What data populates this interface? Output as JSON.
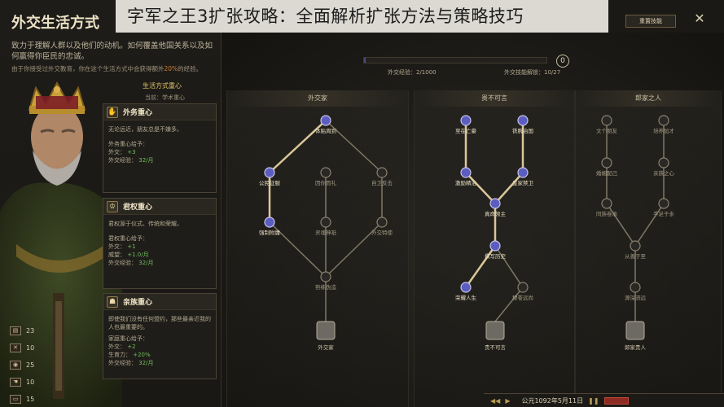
{
  "overlay_title": "字军之王3扩张攻略：全面解析扩张方法与策略技巧",
  "panel": {
    "title": "外交生活方式",
    "intro": "致力于理解人群以及他们的动机。如何覆盖他国关系以及如何赢得你臣民的忠诚。",
    "intro2_prefix": "由于你接受过外交教育，你在这个生活方式中会获得额外",
    "intro2_pct": "20%",
    "intro2_suffix": "的经验。",
    "focus_header": "生活方式重心",
    "focus_current": "当前：学术重心"
  },
  "focus_cards": [
    {
      "name": "外务重心",
      "icon": "handshake-icon",
      "desc": "无论远近，朋友总是不嫌多。",
      "gain_label": "外务重心给予：",
      "line1_label": "外交：",
      "line1_value": "+3",
      "xp_line": "外交经验：",
      "xp_value": "32/月"
    },
    {
      "name": "君权重心",
      "icon": "crown-icon",
      "desc": "君权源于仪式、传统和荣耀。",
      "gain_label": "君权重心给予：",
      "line1_label": "外交：",
      "line1_value": "+1",
      "line2_label": "威望：",
      "line2_value": "+1.0/月",
      "xp_line": "外交经验：",
      "xp_value": "32/月"
    },
    {
      "name": "亲族重心",
      "icon": "family-icon",
      "desc": "即使我们没有任何盟约，那些最亲近我的人也最重要的。",
      "gain_label": "家庭重心给予：",
      "line1_label": "外交：",
      "line1_value": "+2",
      "line2_label": "生育力：",
      "line2_value": "+20%",
      "xp_line": "外交经验：",
      "xp_value": "32/月"
    }
  ],
  "stats": [
    {
      "icon": "scroll-icon",
      "value": "23"
    },
    {
      "icon": "swords-icon",
      "value": "10"
    },
    {
      "icon": "coins-icon",
      "value": "25"
    },
    {
      "icon": "hand-icon",
      "value": "10"
    },
    {
      "icon": "book-icon",
      "value": "15"
    }
  ],
  "header": {
    "encyclopedia_button": "重置技能",
    "xp_label": "外交经验：2/1000",
    "perk_points_label": "外交技能解锁：10/27",
    "perk_points_badge": "0",
    "progress_fraction": 0.002
  },
  "trees": [
    {
      "name": "外交家",
      "nodes": [
        {
          "id": "a1",
          "label": "体贴周到",
          "col": 1,
          "row": 0,
          "unlocked": true
        },
        {
          "id": "a2",
          "label": "公民征服",
          "col": 0,
          "row": 1,
          "unlocked": true
        },
        {
          "id": "a3",
          "label": "因你而礼",
          "col": 1,
          "row": 1,
          "unlocked": false
        },
        {
          "id": "a4",
          "label": "自卫反击",
          "col": 2,
          "row": 1,
          "unlocked": false
        },
        {
          "id": "a5",
          "label": "强制附庸",
          "col": 0,
          "row": 2,
          "unlocked": true
        },
        {
          "id": "a6",
          "label": "灵魂神祇",
          "col": 1,
          "row": 2,
          "unlocked": false
        },
        {
          "id": "a7",
          "label": "外交特使",
          "col": 2,
          "row": 2,
          "unlocked": false
        },
        {
          "id": "a8",
          "label": "熟练伪造",
          "col": 1,
          "row": 3,
          "unlocked": false
        }
      ],
      "capstone": "外交家",
      "edges": [
        [
          "a1",
          "a2"
        ],
        [
          "a1",
          "a4"
        ],
        [
          "a2",
          "a5"
        ],
        [
          "a3",
          "a6"
        ],
        [
          "a4",
          "a7"
        ],
        [
          "a5",
          "a8"
        ],
        [
          "a6",
          "a8"
        ],
        [
          "a7",
          "a8"
        ]
      ]
    },
    {
      "name": "贵不可言",
      "nodes": [
        {
          "id": "b1",
          "label": "至在亡豪",
          "col": 0,
          "row": 0,
          "unlocked": true
        },
        {
          "id": "b2",
          "label": "铁腕治国",
          "col": 2,
          "row": 0,
          "unlocked": true
        },
        {
          "id": "b3",
          "label": "激励精治",
          "col": 0,
          "row": 1,
          "unlocked": true
        },
        {
          "id": "b4",
          "label": "皇家禁卫",
          "col": 2,
          "row": 1,
          "unlocked": true
        },
        {
          "id": "b5",
          "label": "真命领主",
          "col": 1,
          "row": 2,
          "unlocked": true
        },
        {
          "id": "b6",
          "label": "撰写历史",
          "col": 1,
          "row": 3,
          "unlocked": true
        },
        {
          "id": "b7",
          "label": "荣耀人生",
          "col": 0,
          "row": 4,
          "unlocked": true
        },
        {
          "id": "b8",
          "label": "穆苍远尚",
          "col": 2,
          "row": 4,
          "unlocked": false
        }
      ],
      "capstone": "贵不可言",
      "edges": [
        [
          "b1",
          "b3"
        ],
        [
          "b2",
          "b4"
        ],
        [
          "b3",
          "b5"
        ],
        [
          "b4",
          "b5"
        ],
        [
          "b5",
          "b6"
        ],
        [
          "b6",
          "b7"
        ],
        [
          "b6",
          "b8"
        ]
      ]
    },
    {
      "name": "郎家之人",
      "nodes": [
        {
          "id": "c1",
          "label": "文个朋友",
          "col": 0,
          "row": 0,
          "unlocked": false
        },
        {
          "id": "c2",
          "label": "培养加才",
          "col": 2,
          "row": 0,
          "unlocked": false
        },
        {
          "id": "c3",
          "label": "婚姻配己",
          "col": 0,
          "row": 1,
          "unlocked": false
        },
        {
          "id": "c4",
          "label": "亲族之心",
          "col": 2,
          "row": 1,
          "unlocked": false
        },
        {
          "id": "c5",
          "label": "同族卷承",
          "col": 0,
          "row": 2,
          "unlocked": false
        },
        {
          "id": "c6",
          "label": "手足于永",
          "col": 2,
          "row": 2,
          "unlocked": false
        },
        {
          "id": "c7",
          "label": "从善于至",
          "col": 1,
          "row": 3,
          "unlocked": false
        },
        {
          "id": "c8",
          "label": "源深流远",
          "col": 1,
          "row": 4,
          "unlocked": false
        }
      ],
      "capstone": "郎家贵人",
      "edges": [
        [
          "c1",
          "c3"
        ],
        [
          "c2",
          "c4"
        ],
        [
          "c3",
          "c5"
        ],
        [
          "c4",
          "c6"
        ],
        [
          "c5",
          "c7"
        ],
        [
          "c6",
          "c7"
        ],
        [
          "c7",
          "c8"
        ]
      ]
    }
  ],
  "bottom_bar": {
    "date": "公元1092年5月11日",
    "play_icon": "play-icon"
  },
  "colors": {
    "unlocked_node": "#5b5ec0",
    "locked_node": "#2a2824",
    "unlocked_edge": "#d9c79a",
    "locked_edge": "#7f7866",
    "accent_gold": "#d4b35a",
    "positive": "#6fbf5a"
  }
}
